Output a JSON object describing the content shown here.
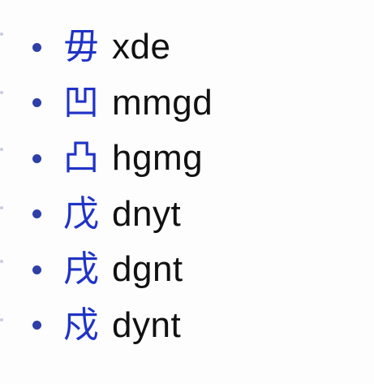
{
  "colors": {
    "bullet": "#2f3fa8",
    "glyph": "#1f33c7",
    "text": "#111111",
    "background": "#fdfdfd"
  },
  "list": {
    "items": [
      {
        "glyph": "毋",
        "label": "xde"
      },
      {
        "glyph": "凹",
        "label": "mmgd"
      },
      {
        "glyph": "凸",
        "label": "hgmg"
      },
      {
        "glyph": "戊",
        "label": "dnyt"
      },
      {
        "glyph": "戌",
        "label": "dgnt"
      },
      {
        "glyph": "戍",
        "label": "dynt"
      }
    ]
  }
}
